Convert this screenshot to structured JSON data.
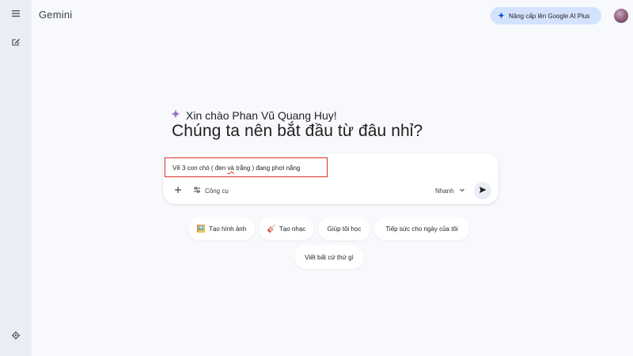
{
  "app": {
    "title": "Gemini"
  },
  "header": {
    "upgrade_label": "Nâng cấp lên Google AI Plus"
  },
  "greeting": {
    "hello": "Xin chào Phan Vũ Quang Huy!",
    "headline": "Chúng ta nên bắt đầu từ đâu nhỉ?"
  },
  "prompt": {
    "text_before": "Vẽ 3 con chó ( đen ",
    "text_underlined": "và",
    "text_after": " trắng ) đang phơi nắng",
    "tools_label": "Công cụ",
    "model_label": "Nhanh"
  },
  "chips": [
    {
      "label": "Tạo hình ảnh",
      "icon": "🖼️"
    },
    {
      "label": "Tạo nhạc",
      "icon": "🎸"
    },
    {
      "label": "Giúp tôi học"
    },
    {
      "label": "Tiếp sức cho ngày của tôi"
    },
    {
      "label": "Viết bất cứ thứ gì"
    }
  ],
  "colors": {
    "accent": "#d3e3fd",
    "highlight_border": "#d93025",
    "background": "#f7f9fc"
  },
  "icons": {
    "menu": "menu-icon",
    "new_chat": "edit-icon",
    "settings": "gear-icon",
    "sparkle": "sparkle-icon",
    "add": "plus-icon",
    "tools": "tune-icon",
    "dropdown": "chevron-down-icon",
    "send": "send-icon"
  }
}
